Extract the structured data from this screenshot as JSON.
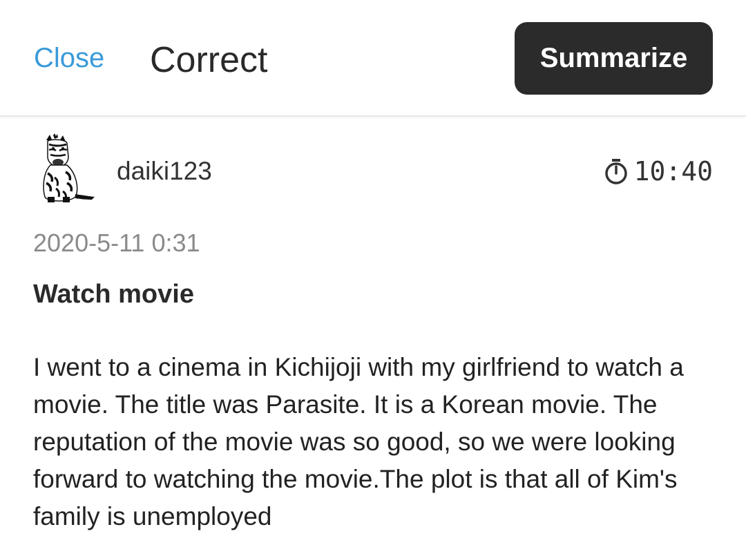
{
  "header": {
    "close_label": "Close",
    "title": "Correct",
    "summarize_label": "Summarize"
  },
  "post": {
    "author": "daiki123",
    "timer": "10:40",
    "date": "2020-5-11 0:31",
    "title": "Watch movie",
    "body": "I went to a cinema in Kichijoji with my girlfriend to watch a movie. The title was Parasite. It is a Korean movie. The reputation of the movie was so good, so we were looking forward to watching the movie.The plot is that all of Kim's family is unemployed"
  },
  "icons": {
    "avatar": "zebra-avatar-icon",
    "timer": "stopwatch-icon"
  },
  "colors": {
    "accent": "#3a9ad9",
    "button_bg": "#2b2b2b",
    "muted_text": "#8a8a8a"
  }
}
